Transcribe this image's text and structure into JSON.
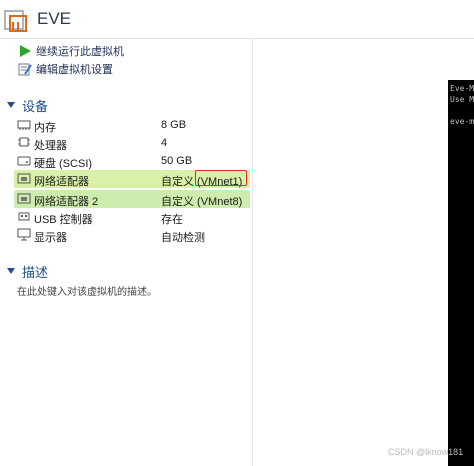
{
  "header": {
    "title": "EVE"
  },
  "actions": [
    {
      "label": "继续运行此虚拟机",
      "icon": "play-icon"
    },
    {
      "label": "编辑虚拟机设置",
      "icon": "edit-settings-icon"
    }
  ],
  "devices": {
    "title": "设备",
    "items": [
      {
        "name": "内存",
        "value": "8 GB",
        "icon": "memory-icon"
      },
      {
        "name": "处理器",
        "value": "4",
        "icon": "cpu-icon"
      },
      {
        "name": "硬盘 (SCSI)",
        "value": "50 GB",
        "icon": "disk-icon"
      },
      {
        "name": "网络适配器",
        "value": "自定义 (VMnet1)",
        "icon": "network-adapter-icon"
      },
      {
        "name": "网络适配器 2",
        "value": "自定义 (VMnet8)",
        "icon": "network-adapter-icon"
      },
      {
        "name": "USB 控制器",
        "value": "存在",
        "icon": "usb-icon"
      },
      {
        "name": "显示器",
        "value": "自动检测",
        "icon": "monitor-icon"
      }
    ]
  },
  "description": {
    "title": "描述",
    "placeholder": "在此处键入对该虚拟机的描述。"
  },
  "console": {
    "lines": [
      "Eve-M",
      "Use M",
      "eve-m"
    ]
  },
  "watermark": "CSDN @lknow181"
}
